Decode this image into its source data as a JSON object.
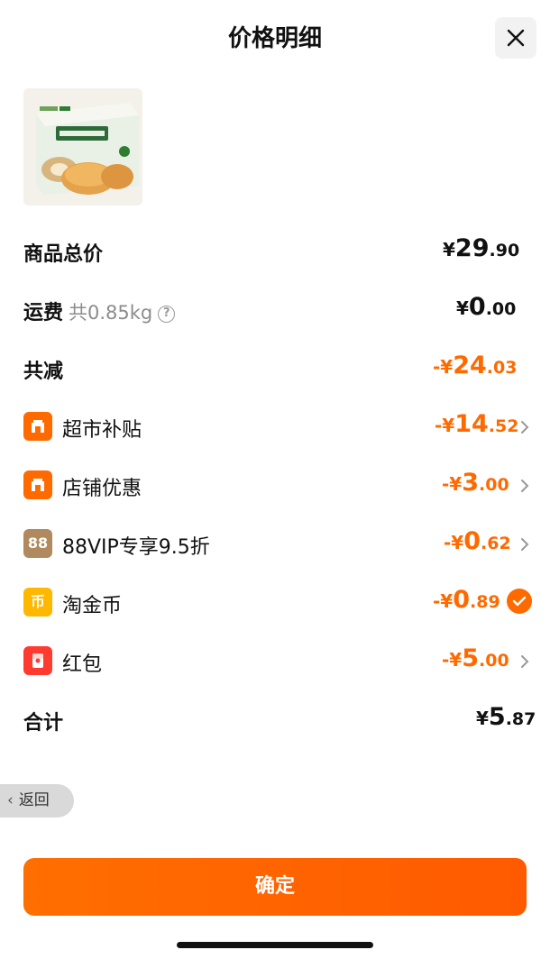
{
  "header": {
    "title": "价格明细"
  },
  "summary": {
    "goods_total": {
      "label": "商品总价",
      "cur": "¥",
      "int": "29",
      "dec": ".90"
    },
    "shipping": {
      "label": "运费",
      "weight": "共0.85kg",
      "help": "?",
      "cur": "¥",
      "int": "0",
      "dec": ".00"
    },
    "total_discount": {
      "label": "共减",
      "cur": "-¥",
      "int": "24",
      "dec": ".03"
    }
  },
  "discounts": [
    {
      "label": "超市补贴",
      "icon": "shop-icon",
      "color": "#ff6a00",
      "cur": "-¥",
      "int": "14",
      "dec": ".52"
    },
    {
      "label": "店铺优惠",
      "icon": "store-icon",
      "color": "#ff6a00",
      "cur": "-¥",
      "int": "3",
      "dec": ".00"
    },
    {
      "label": "88VIP专享9.5折",
      "icon": "88vip-icon",
      "badge": "88",
      "color": "#b08a5e",
      "cur": "-¥",
      "int": "0",
      "dec": ".62"
    },
    {
      "label": "淘金币",
      "icon": "coin-icon",
      "badge": "币",
      "color": "#ffb800",
      "cur": "-¥",
      "int": "0",
      "dec": ".89"
    },
    {
      "label": "红包",
      "icon": "red-packet-icon",
      "color": "#ff3b30",
      "cur": "-¥",
      "int": "5",
      "dec": ".00"
    }
  ],
  "final_total": {
    "label": "合计",
    "cur": "¥",
    "int": "5",
    "dec": ".87"
  },
  "back": {
    "label": "返回"
  },
  "confirm": {
    "label": "确定"
  },
  "colors": {
    "accent": "#ff6a00",
    "text": "#111111",
    "muted": "#8c8c8c"
  }
}
